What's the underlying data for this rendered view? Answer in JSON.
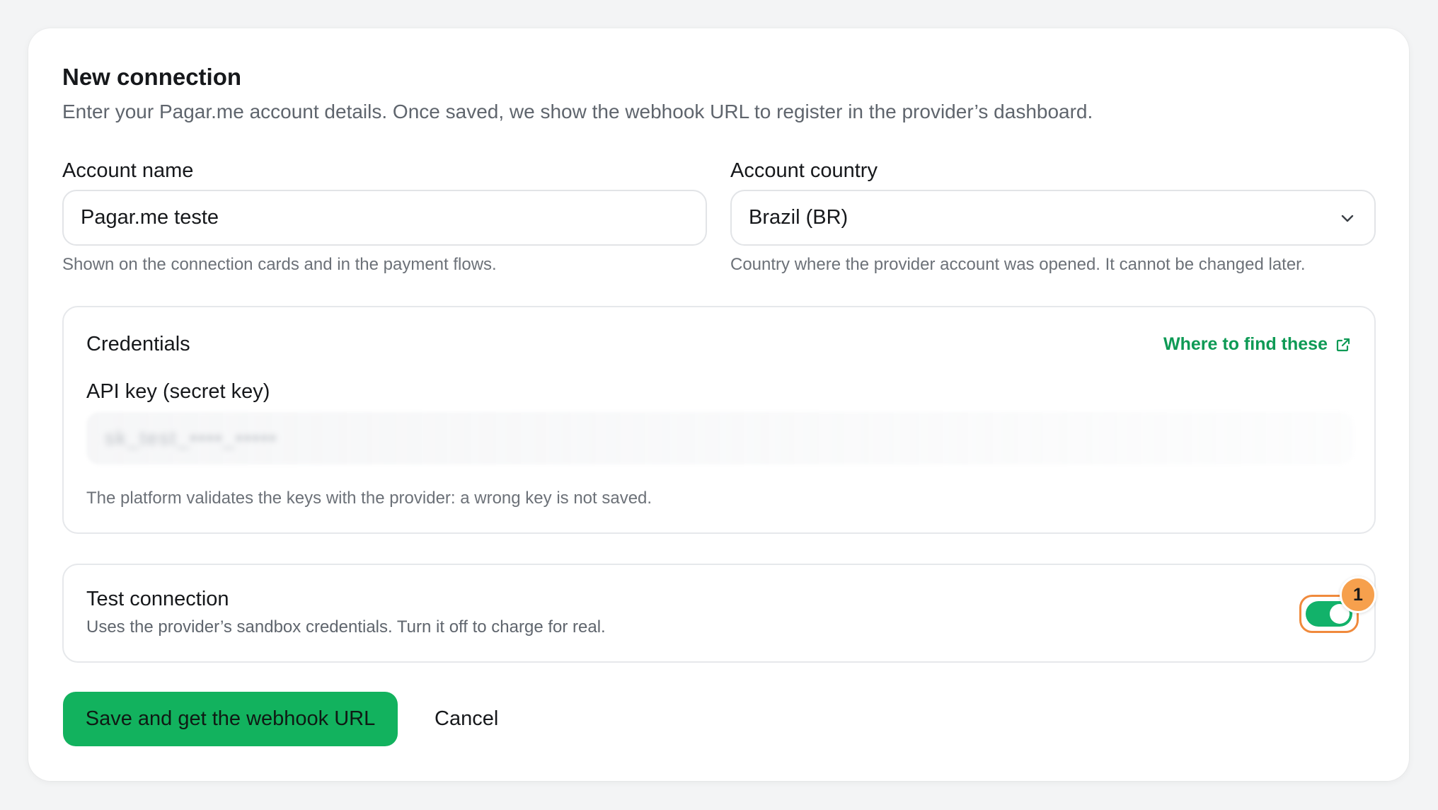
{
  "form": {
    "title": "New connection",
    "subtitle": "Enter your Pagar.me account details. Once saved, we show the webhook URL to register in the provider’s dashboard."
  },
  "account_name": {
    "label": "Account name",
    "value": "Pagar.me teste",
    "help": "Shown on the connection cards and in the payment flows."
  },
  "account_country": {
    "label": "Account country",
    "value": "Brazil (BR)",
    "help": "Country where the provider account was opened. It cannot be changed later.",
    "icon": "chevron-down-icon"
  },
  "credentials": {
    "title": "Credentials",
    "link_label": "Where to find these",
    "link_icon": "external-link-icon",
    "api_key_label": "API key (secret key)",
    "api_key_value": "sk_test_••••_•••••",
    "help": "The platform validates the keys with the provider: a wrong key is not saved."
  },
  "test_connection": {
    "title": "Test connection",
    "description": "Uses the provider’s sandbox credentials. Turn it off to charge for real.",
    "enabled": true,
    "badge": "1"
  },
  "actions": {
    "save_label": "Save and get the webhook URL",
    "cancel_label": "Cancel"
  },
  "colors": {
    "accent": "#12b25e",
    "link": "#0e9a55",
    "highlight": "#f08a3c",
    "badge": "#f6a04d"
  }
}
